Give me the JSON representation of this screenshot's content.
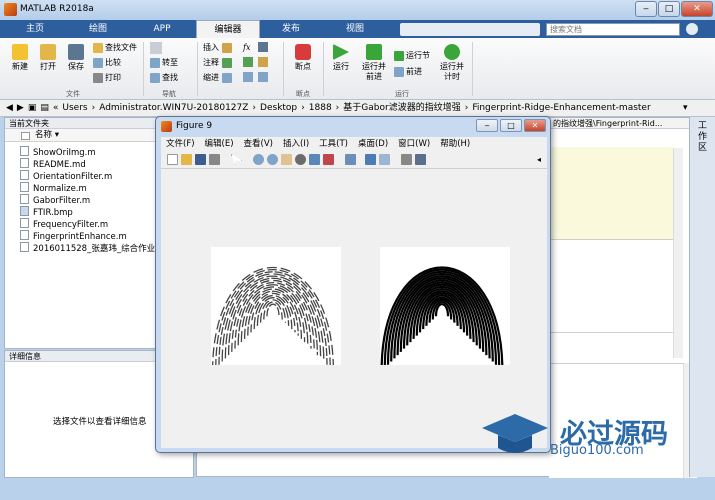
{
  "window": {
    "title": "MATLAB R2018a",
    "minimize": "‒",
    "maximize": "□",
    "close": "✕"
  },
  "tabs": [
    {
      "label": "主页"
    },
    {
      "label": "绘图"
    },
    {
      "label": "APP"
    },
    {
      "label": "编辑器"
    },
    {
      "label": "发布"
    },
    {
      "label": "视图"
    }
  ],
  "search_placeholder": "搜索文档",
  "ribbon": {
    "file_group": {
      "new": "新建",
      "open": "打开",
      "save": "保存",
      "find_files": "查找文件",
      "compare": "比较",
      "print": "打印",
      "label": "文件"
    },
    "nav_group": {
      "insert": "插入",
      "comment": "注释",
      "indent": "缩进",
      "goto": "转至",
      "find": "查找",
      "label": "导航"
    },
    "edit_group": {
      "fx": "fx"
    },
    "bp_group": {
      "breakpoints": "断点",
      "label": "断点"
    },
    "run_group": {
      "run": "运行",
      "run_advance": "运行并前进",
      "run_section": "运行节",
      "advance": "前进",
      "run_time": "运行并计时",
      "label": "运行"
    }
  },
  "address": {
    "path": [
      "Users",
      "Administrator.WIN7U-20180127Z",
      "Desktop",
      "1888",
      "基于Gabor滤波器的指纹增强",
      "Fingerprint-Ridge-Enhancement-master"
    ],
    "right_path": "的指纹增强\\Fingerprint-Rid..."
  },
  "current_folder": {
    "title": "当前文件夹",
    "name_col": "名称 ▾",
    "files": [
      "ShowOriImg.m",
      "README.md",
      "OrientationFilter.m",
      "Normalize.m",
      "GaborFilter.m",
      "FTIR.bmp",
      "FrequencyFilter.m",
      "FingerprintEnhance.m",
      "2016011528_张嘉玮_综合作业_1..."
    ]
  },
  "details": {
    "title": "详细信息",
    "message": "选择文件以查看详细信息"
  },
  "side_strip": {
    "label": "工作区"
  },
  "figure": {
    "title": "Figure 9",
    "menu": [
      "文件(F)",
      "编辑(E)",
      "查看(V)",
      "插入(I)",
      "工具(T)",
      "桌面(D)",
      "窗口(W)",
      "帮助(H)"
    ]
  },
  "watermark": {
    "text": "必过源码",
    "sub": "Biguo100.com"
  },
  "colors": {
    "tab_bar": "#2d5e9e",
    "accent_blue": "#2d6aa8",
    "editor_highlight": "#fbf9dc"
  }
}
